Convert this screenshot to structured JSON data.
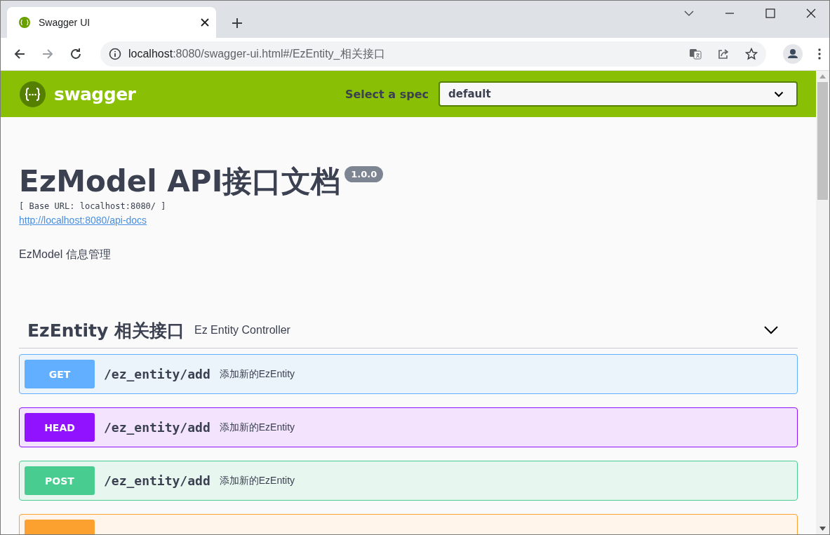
{
  "browser": {
    "tab": {
      "title": "Swagger UI"
    },
    "address": {
      "host": "localhost",
      "rest": ":8080/swagger-ui.html#/EzEntity_相关接口"
    }
  },
  "topbar": {
    "logo_text": "swagger",
    "spec_label": "Select a spec",
    "spec_value": "default"
  },
  "info": {
    "title": "EzModel API接口文档",
    "version": "1.0.0",
    "base_url": "[ Base URL: localhost:8080/ ]",
    "docs_link": "http://localhost:8080/api-docs",
    "description": "EzModel 信息管理"
  },
  "section": {
    "name": "EzEntity 相关接口",
    "description": "Ez Entity Controller",
    "expanded": true,
    "operations": [
      {
        "kind": "get",
        "method": "GET",
        "path": "/ez_entity/add",
        "summary": "添加新的EzEntity"
      },
      {
        "kind": "head",
        "method": "HEAD",
        "path": "/ez_entity/add",
        "summary": "添加新的EzEntity"
      },
      {
        "kind": "post",
        "method": "POST",
        "path": "/ez_entity/add",
        "summary": "添加新的EzEntity"
      },
      {
        "kind": "put"
      }
    ]
  }
}
